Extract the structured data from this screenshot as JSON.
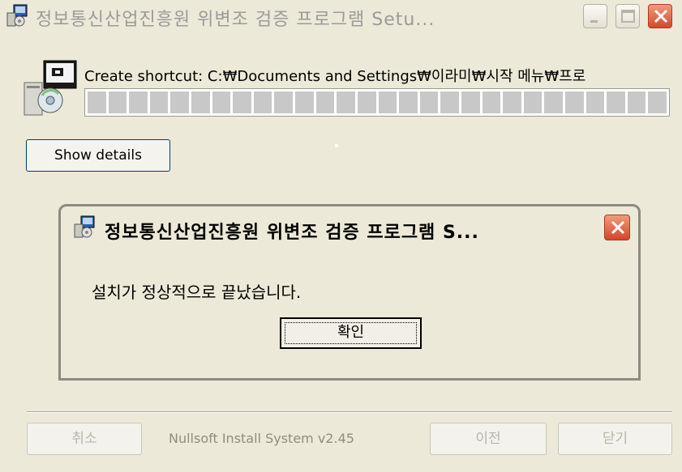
{
  "window": {
    "title": "정보통신산업진흥원 위변조 검증 프로그램 Setu...",
    "icon": "installer-icon",
    "controls": [
      "minimize-icon",
      "maximize-icon",
      "close-icon"
    ]
  },
  "install": {
    "status_text": "Create shortcut: C:₩Documents and Settings₩이라미₩시작 메뉴₩프로",
    "progress": 1.0,
    "show_details_label": "Show details"
  },
  "footer": {
    "cancel_label": "취소",
    "brand_text": "Nullsoft Install System v2.45",
    "back_label": "이전",
    "close_label": "닫기"
  },
  "dialog": {
    "title": "정보통신산업진흥원 위변조 검증 프로그램 S...",
    "message": "설치가 정상적으로 끝났습니다.",
    "ok_label": "확인"
  },
  "colors": {
    "background": "#ece9d8",
    "close_button": "#d2492a",
    "progress_segment": "#c8c8c8"
  }
}
